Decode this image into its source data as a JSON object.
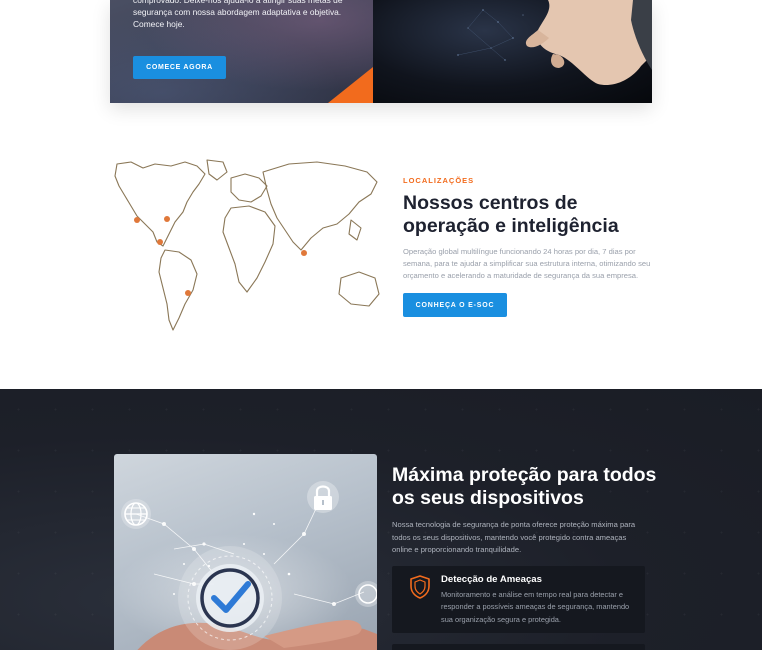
{
  "hero": {
    "text": "comprovado. Deixe-nos ajudá-lo a atingir suas metas de segurança com nossa abordagem adaptativa e objetiva. Comece hoje.",
    "cta_label": "COMECE AGORA",
    "accent_color": "#f26b1d",
    "button_color": "#1a8fe0"
  },
  "locations": {
    "eyebrow": "LOCALIZAÇÕES",
    "title": "Nossos centros de operação e inteligência",
    "description": "Operação global multilíngue funcionando 24 horas por dia, 7 dias por semana, para te ajudar a simplificar sua estrutura interna, otimizando seu orçamento e acelerando a maturidade de segurança da sua empresa.",
    "cta_label": "CONHEÇA O E-SOC",
    "marker_color": "#e0783a"
  },
  "protection": {
    "title": "Máxima proteção para todos os seus dispositivos",
    "description": "Nossa tecnologia de segurança de ponta oferece proteção máxima para todos os seus dispositivos, mantendo você protegido contra ameaças online e proporcionando tranquilidade.",
    "features": [
      {
        "icon": "shield-icon",
        "title": "Detecção de Ameaças",
        "description": "Monitoramento e análise em tempo real para detectar e responder a possíveis ameaças de segurança, mantendo sua organização segura e protegida."
      }
    ]
  }
}
